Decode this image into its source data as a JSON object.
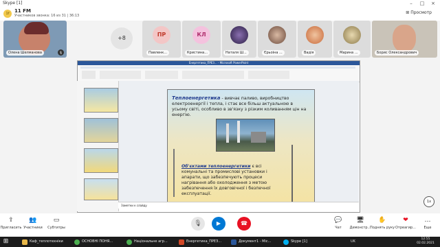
{
  "window": {
    "app_title": "Skype [1]"
  },
  "call": {
    "badge": "1f",
    "title": "11 FM",
    "subtitle": "Участников звонка: 16 из 31 | 36:13",
    "view_label": "Просмотр",
    "more_count": "+8"
  },
  "participants": [
    {
      "name": "Олена Шелманова"
    },
    {
      "name": "Павленк...",
      "initials": "ПР",
      "color": "#f3c6c6",
      "text": "#c0392b"
    },
    {
      "name": "Кристина...",
      "initials": "КЛ",
      "color": "#f4c2de",
      "text": "#b0306e"
    },
    {
      "name": "Наталя Ш..."
    },
    {
      "name": "Єрьоіна ..."
    },
    {
      "name": "Вадія"
    },
    {
      "name": "Марина ..."
    },
    {
      "name": "Борис Олександрович"
    }
  ],
  "slide": {
    "heading": "Теплоенергетика",
    "text1": " - вивчає паливо, виробництво електроенергії і тепла, і стає все більш актуальною в усьому світі, особливо в зв'язку з різким коливанням цін на енергію.",
    "heading2": "Об'єктами теплоенергетики",
    "text2": " є всі комунальні та промислові установки і апарати, що забезпечують процеси нагрівання або охолодження з метою забезпечення їх довговічної і безпечної експлуатації."
  },
  "ppt": {
    "window_title": "Енергетика_ПРЕЗ... - Microsoft PowerPoint",
    "notes": "Заметки к слайду"
  },
  "zoom": "1x",
  "controls": {
    "share": "Пригласить",
    "participants": "Участники",
    "subtitles": "Субтитры",
    "chat": "Чат",
    "present": "Демонстр...",
    "raise": "Поднять руку",
    "react": "Отреагир...",
    "more": "Еще"
  },
  "taskbar": [
    {
      "label": "Каф_теплотехніки"
    },
    {
      "label": "ОСНОВНІ ПОНЯ..."
    },
    {
      "label": "Національне агр..."
    },
    {
      "label": "Енергетика_ПРЕЗ..."
    },
    {
      "label": "Документ1 - Mic..."
    },
    {
      "label": "Skype [1]"
    }
  ],
  "clock": {
    "lang": "UK",
    "time": "12:55",
    "date": "02.02.2021"
  }
}
